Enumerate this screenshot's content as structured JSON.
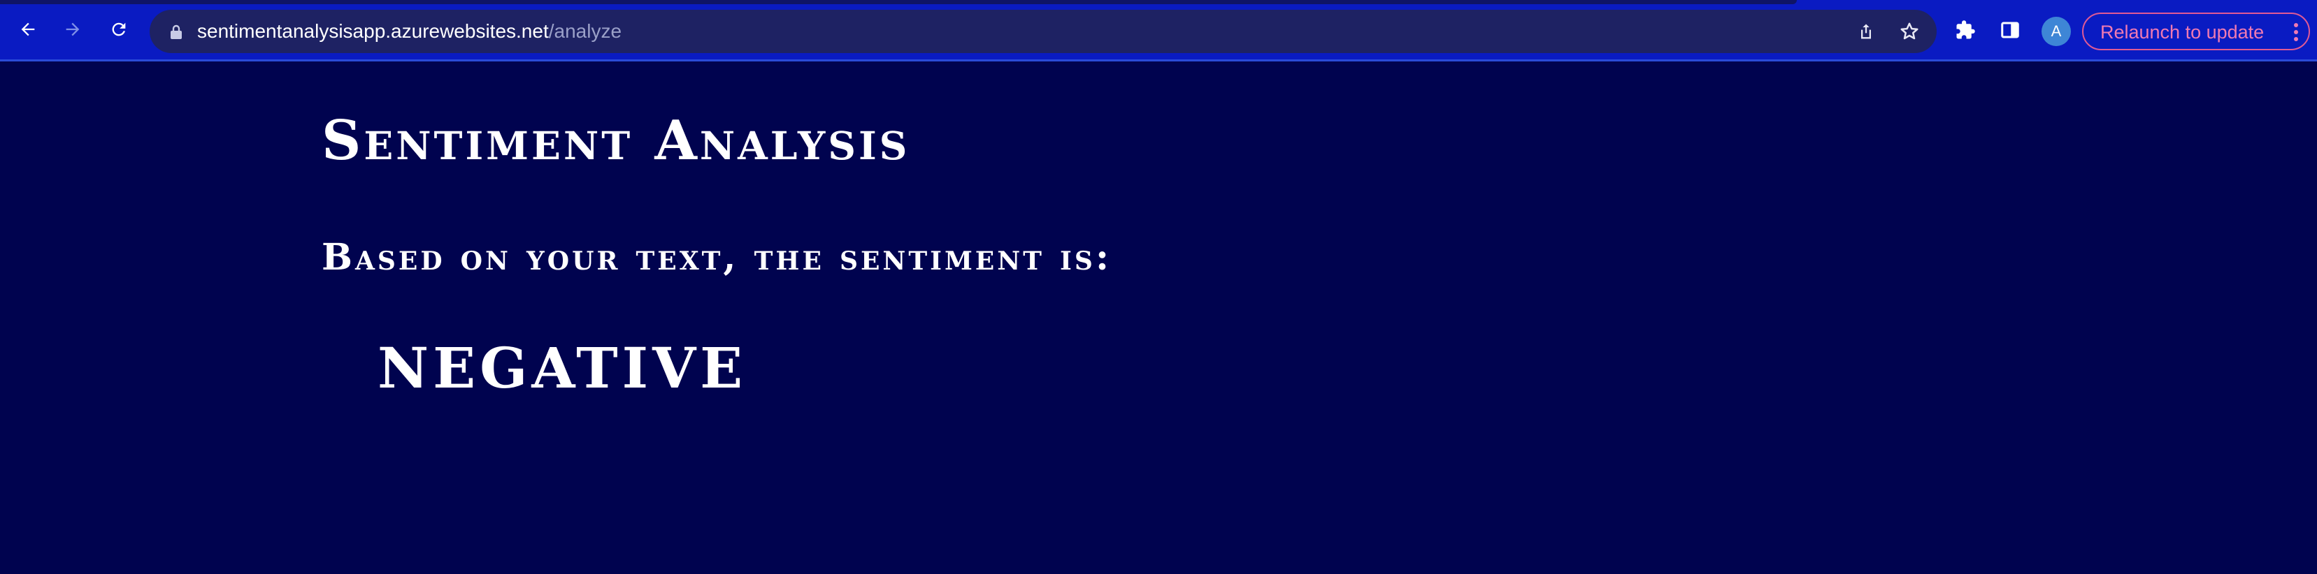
{
  "browser": {
    "url_host": "sentimentanalysisapp.azurewebsites.net",
    "url_path": "/analyze",
    "avatar_letter": "A",
    "relaunch_label": "Relaunch to update",
    "icons": [
      "back-arrow-icon",
      "forward-arrow-icon",
      "reload-icon",
      "lock-icon",
      "share-icon",
      "star-icon",
      "extensions-puzzle-icon",
      "side-panel-icon",
      "kebab-menu-icon"
    ],
    "colors": {
      "toolbar": "#0a1bc2",
      "omnibox": "#1e2263",
      "relaunch_accent": "#e05a95"
    }
  },
  "page": {
    "title": "Sentiment Analysis",
    "subtitle": "Based on your text, the sentiment is:",
    "result": "NEGATIVE",
    "background": "#00034f"
  }
}
